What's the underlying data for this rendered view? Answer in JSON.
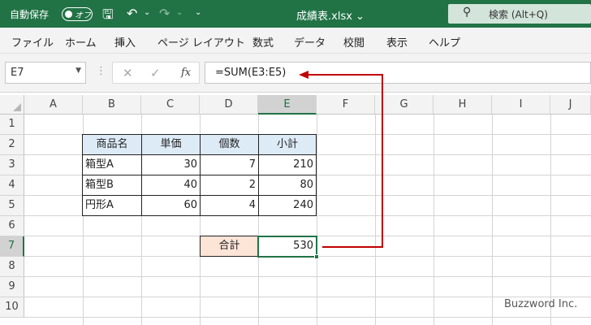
{
  "titlebar": {
    "autosave_label": "自動保存",
    "toggle_label": "オフ",
    "filename": "成績表.xlsx",
    "filename_chevron": "⌄",
    "search_text": "検索 (Alt+Q)"
  },
  "menu": [
    "ファイル",
    "ホーム",
    "挿入",
    "ページ レイアウト",
    "数式",
    "データ",
    "校閲",
    "表示",
    "ヘルプ"
  ],
  "formula_bar": {
    "name_box": "E7",
    "formula": "=SUM(E3:E5)"
  },
  "columns": [
    "A",
    "B",
    "C",
    "D",
    "E",
    "F",
    "G",
    "H",
    "I",
    "J"
  ],
  "rows": [
    "1",
    "2",
    "3",
    "4",
    "5",
    "6",
    "7",
    "8",
    "9",
    "10"
  ],
  "table": {
    "headers": [
      "商品名",
      "単価",
      "個数",
      "小計"
    ],
    "rows": [
      [
        "箱型A",
        "30",
        "7",
        "210"
      ],
      [
        "箱型B",
        "40",
        "2",
        "80"
      ],
      [
        "円形A",
        "60",
        "4",
        "240"
      ]
    ],
    "total_label": "合計",
    "total_value": "530"
  },
  "watermark": "Buzzword Inc.",
  "colors": {
    "excel_green": "#217346",
    "header_fill": "#ddebf7",
    "total_fill": "#fce4d6",
    "arrow_red": "#c00000"
  }
}
